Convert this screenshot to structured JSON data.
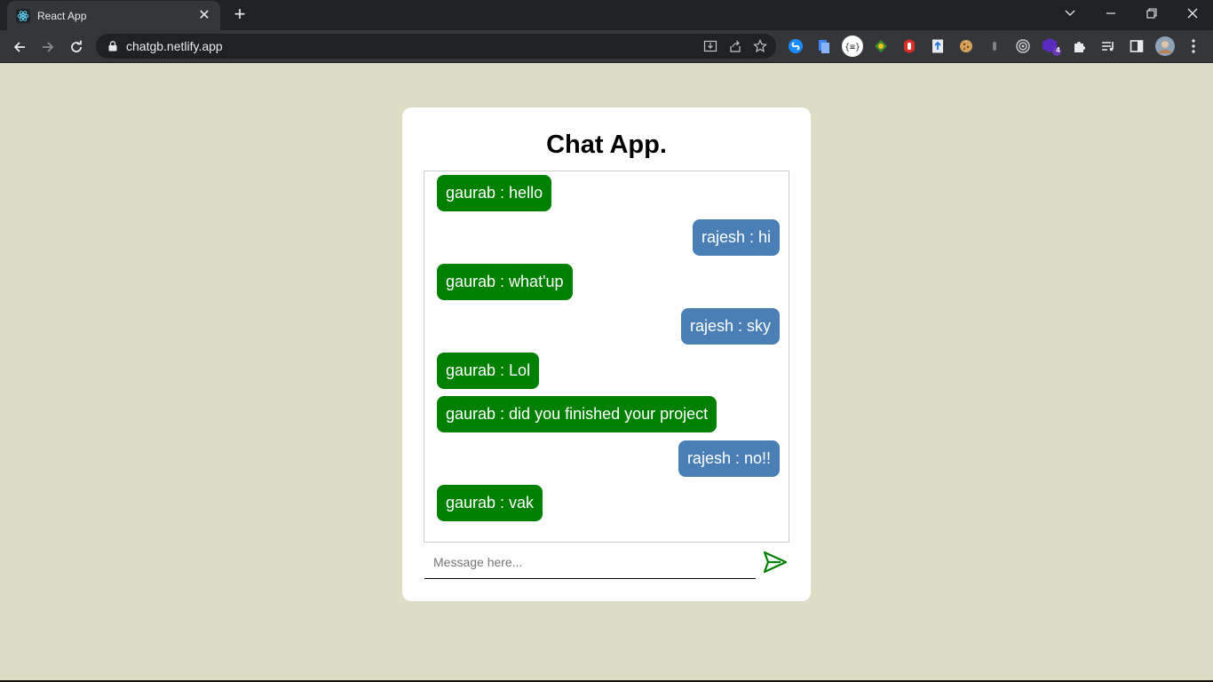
{
  "browser": {
    "tab_title": "React App",
    "url": "chatgb.netlify.app",
    "extension_badge": "4"
  },
  "app": {
    "title": "Chat App.",
    "input_placeholder": "Message here...",
    "messages": [
      {
        "side": "left",
        "text": "gaurab : hello"
      },
      {
        "side": "right",
        "text": "rajesh : hi"
      },
      {
        "side": "left",
        "text": "gaurab : what'up"
      },
      {
        "side": "right",
        "text": "rajesh : sky"
      },
      {
        "side": "left",
        "text": "gaurab : Lol"
      },
      {
        "side": "left",
        "text": "gaurab : did you finished your project"
      },
      {
        "side": "right",
        "text": "rajesh : no!!"
      },
      {
        "side": "left",
        "text": "gaurab : vak"
      }
    ]
  },
  "colors": {
    "page_background": "#dddcc4",
    "left_bubble": "#008000",
    "right_bubble": "#4a7fb5",
    "send_icon": "#008000"
  }
}
